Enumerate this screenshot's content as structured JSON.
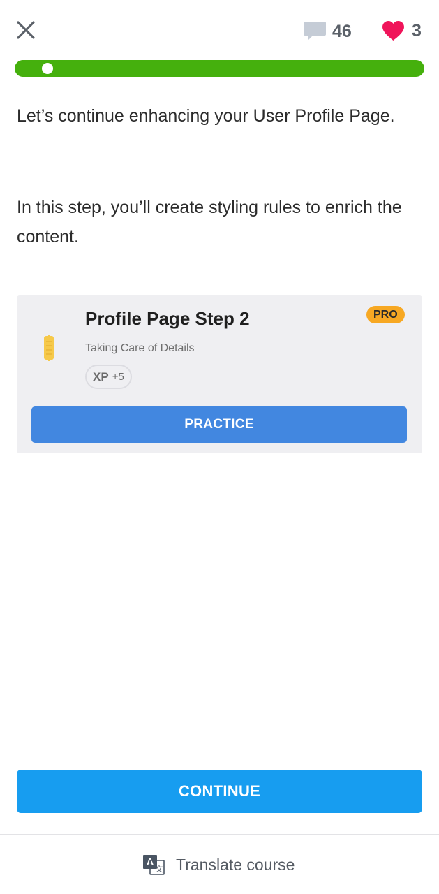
{
  "header": {
    "close_icon": "close-icon",
    "comment_icon": "comment-icon",
    "comments_count": "46",
    "heart_icon": "heart-icon",
    "hearts_count": "3",
    "colors": {
      "heart": "#f0145a",
      "comment": "#c5ccd6",
      "icon_gray": "#5b6169"
    }
  },
  "progress": {
    "value": 0.08,
    "color": "#45b00d"
  },
  "content": {
    "paragraph_1": "Let’s continue enhancing your User Profile Page.",
    "paragraph_2": "In this step, you’ll create styling rules to enrich the content."
  },
  "lesson_card": {
    "title": "Profile Page Step 2",
    "subtitle": "Taking Care of Details",
    "badge": "PRO",
    "xp_label": "XP",
    "xp_amount": "+5",
    "icon": "code-block-icon",
    "action_label": "PRACTICE",
    "colors": {
      "background": "#efeff2",
      "badge": "#f7a823",
      "action": "#4287e0"
    }
  },
  "continue_button": {
    "label": "CONTINUE",
    "color": "#179df0"
  },
  "footer": {
    "translate_label": "Translate course",
    "translate_icon": "translate-icon"
  }
}
